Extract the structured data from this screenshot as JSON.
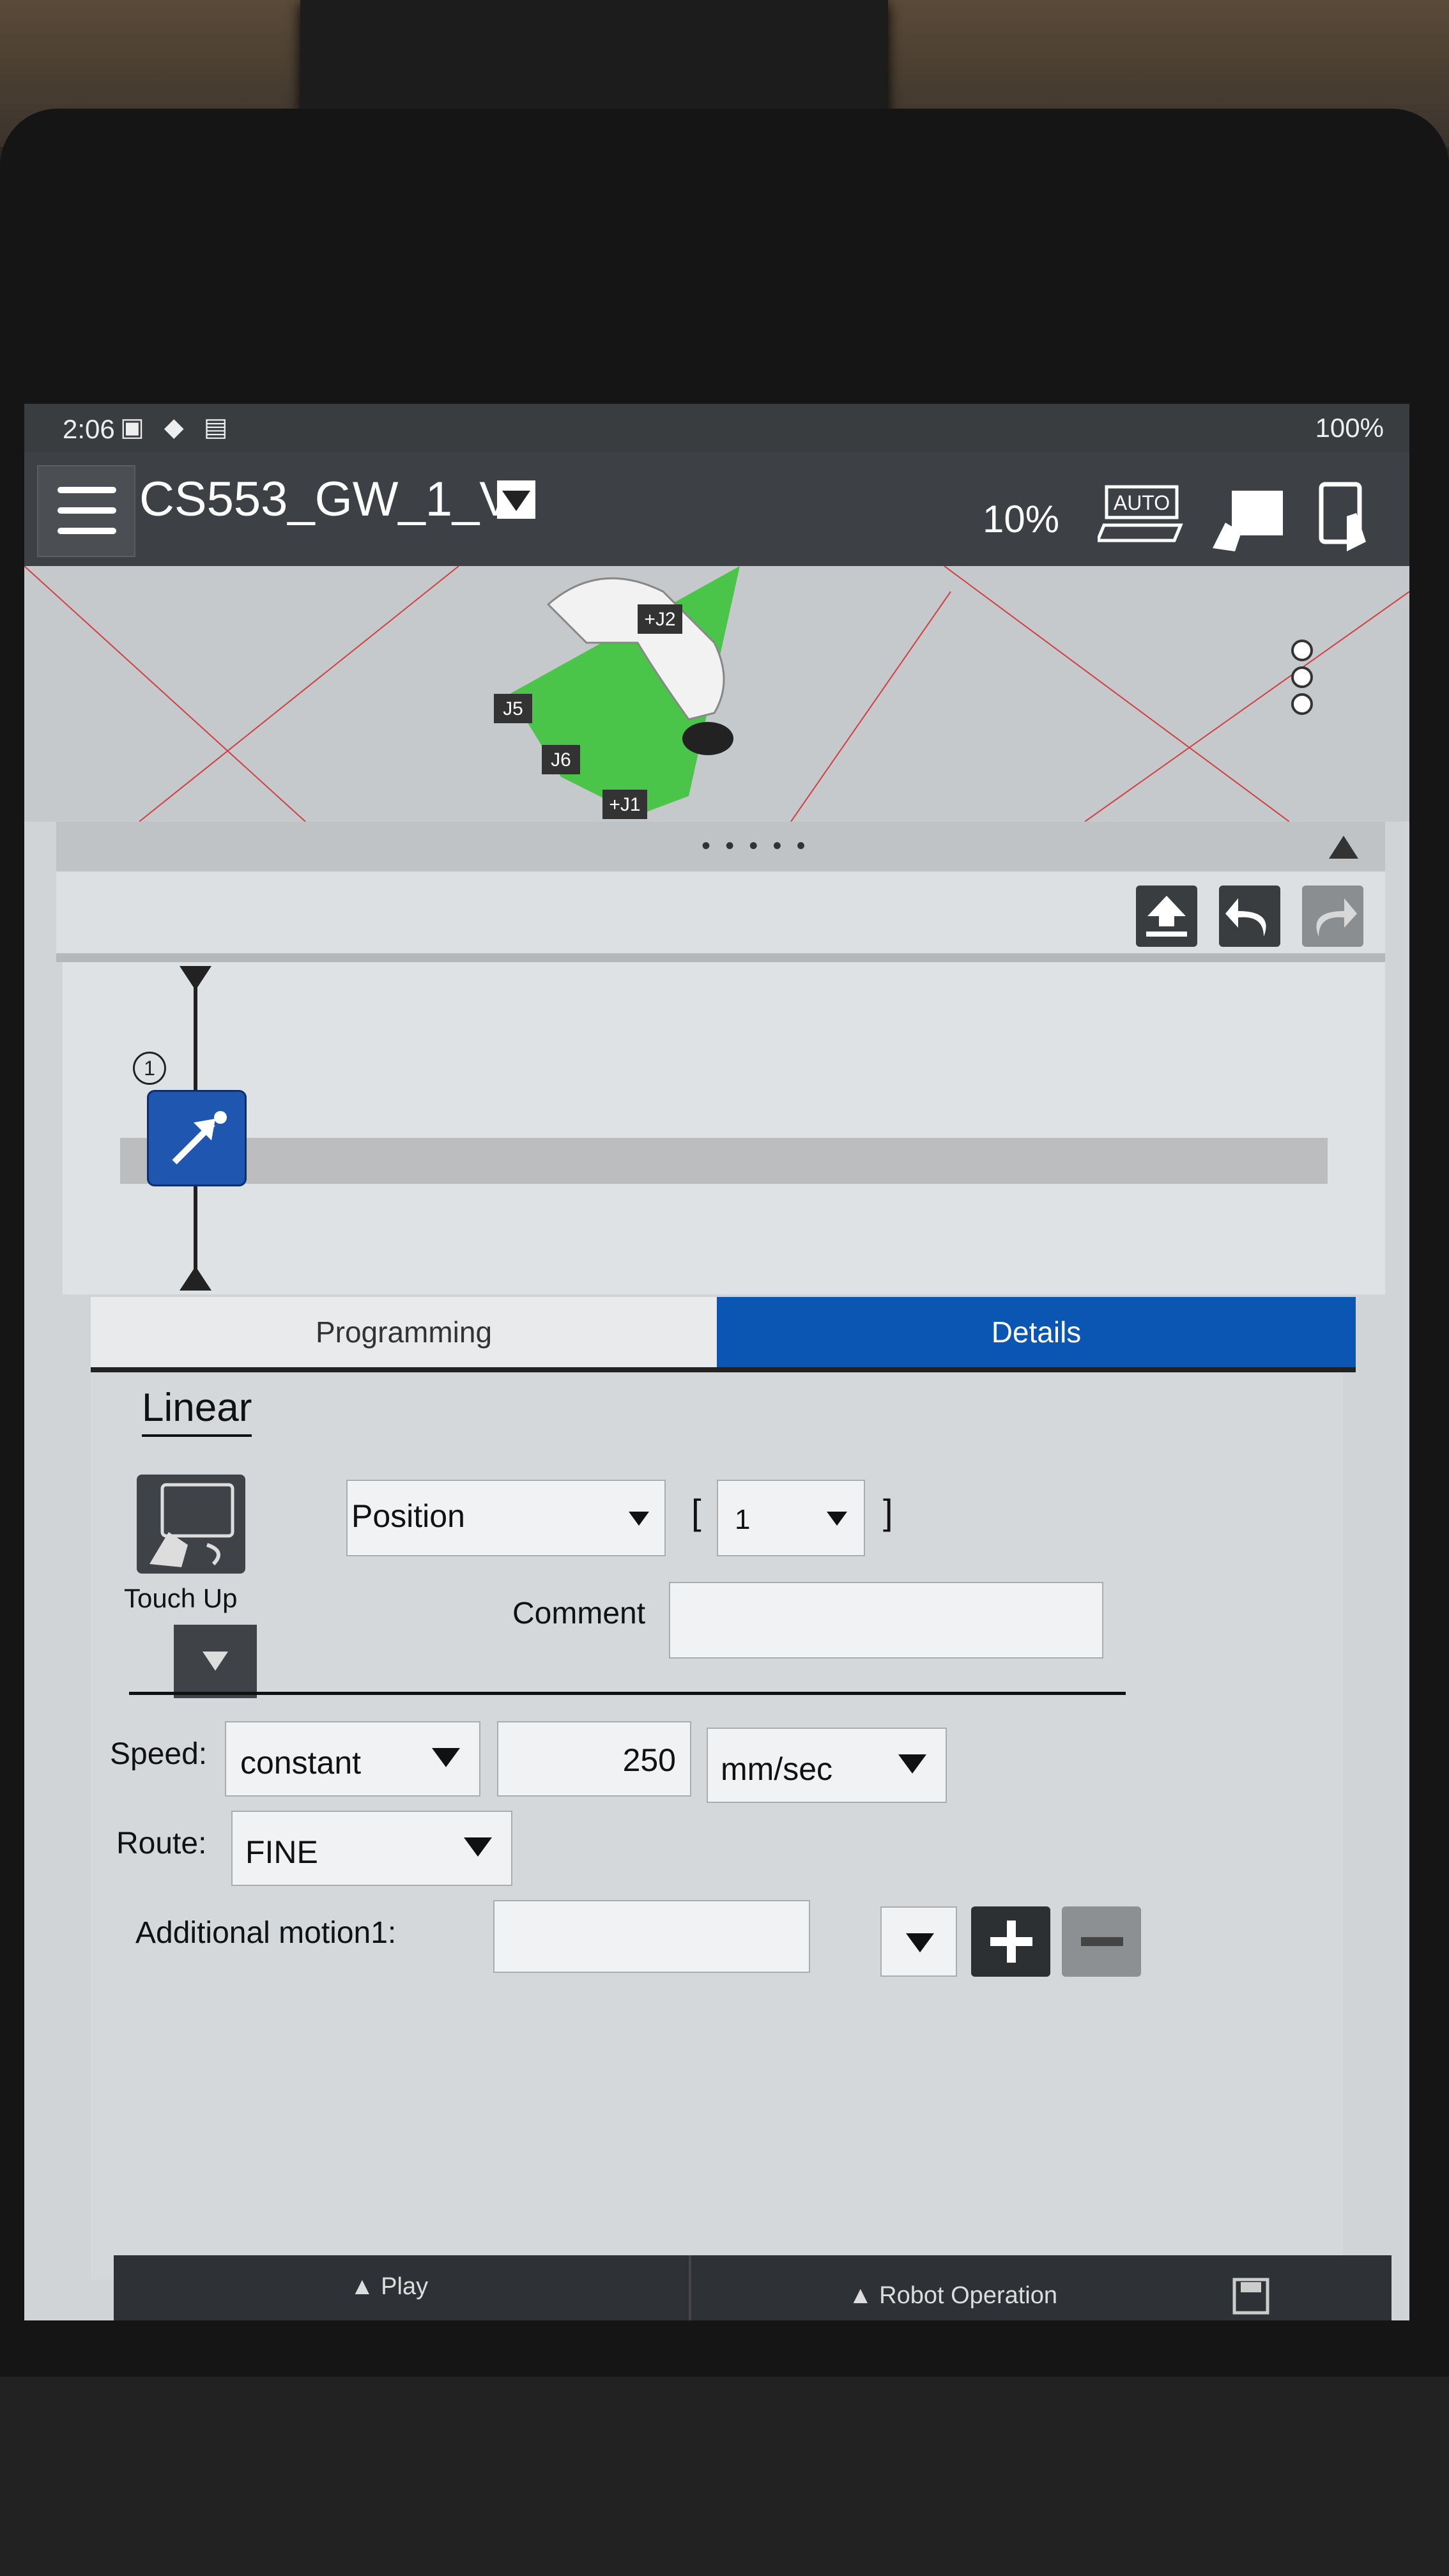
{
  "status_bar": {
    "time": "2:06",
    "battery": "100%"
  },
  "header": {
    "program_name": "CS553_GW_1_V",
    "speed_override": "10%",
    "auto_icon_text": "AUTO"
  },
  "viewport": {
    "joint_labels": [
      "+J2",
      "J5",
      "J6",
      "+J1"
    ]
  },
  "splitter": {
    "dots": "• • • • •"
  },
  "timeline": {
    "step_number": "1"
  },
  "tabs": {
    "programming": "Programming",
    "details": "Details"
  },
  "details": {
    "title": "Linear",
    "touch_up_label": "Touch Up",
    "position_type": "Position",
    "bracket_open": "[",
    "position_index": "1",
    "bracket_close": "]",
    "comment_label": "Comment",
    "comment_value": "",
    "speed_label": "Speed:",
    "speed_type": "constant",
    "speed_value": "250",
    "speed_unit": "mm/sec",
    "route_label": "Route:",
    "route_value": "FINE",
    "additional_motion_label": "Additional motion1:",
    "additional_motion_value": ""
  },
  "footer": {
    "play": "▲ Play",
    "robot_operation": "▲ Robot Operation"
  },
  "colors": {
    "accent_tab": "#0b56b3",
    "motion_block": "#1e56b0",
    "toolbar_dark": "#3a3d40"
  }
}
